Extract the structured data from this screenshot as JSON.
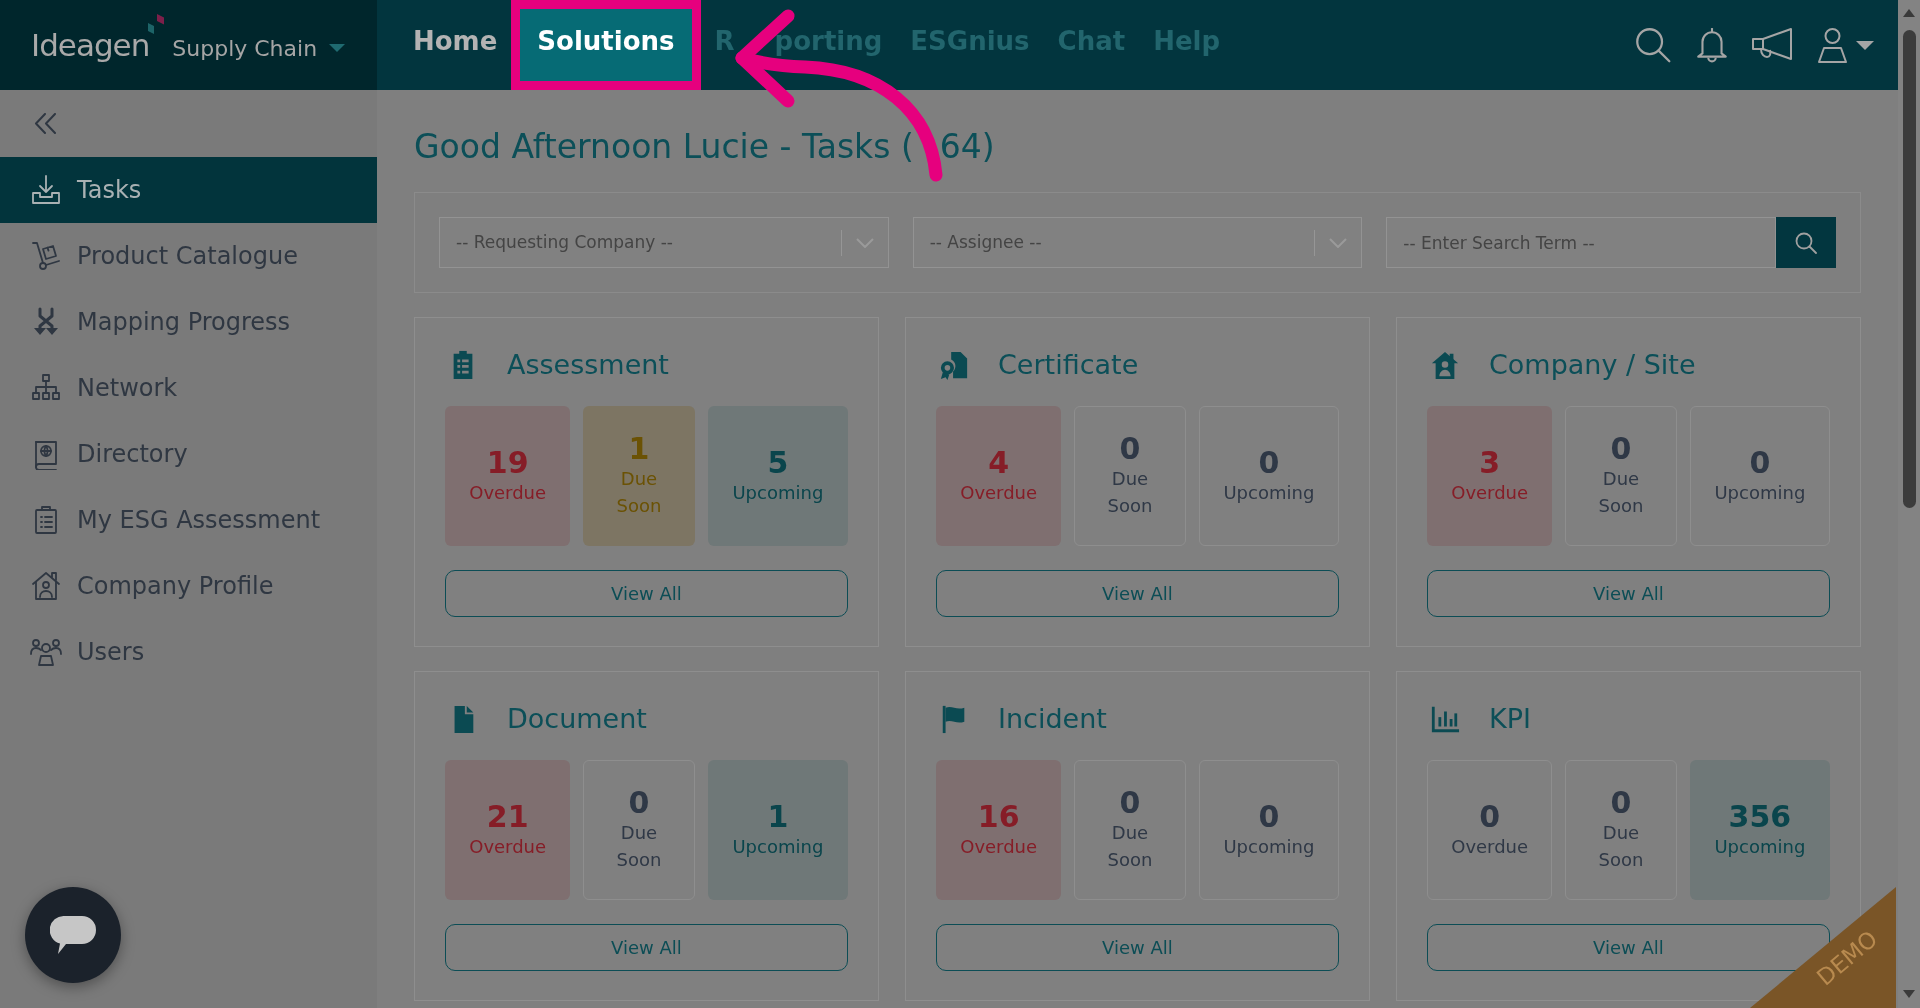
{
  "brand": {
    "name": "Ideagen",
    "product": "Supply Chain"
  },
  "nav": [
    {
      "label": [
        "Home"
      ],
      "selected": false,
      "muted": false,
      "spotlight": false
    },
    {
      "label": [
        "Solutions"
      ],
      "selected": true,
      "muted": false,
      "spotlight": true
    },
    {
      "label": [
        "R",
        "porting"
      ],
      "selected": false,
      "muted": true,
      "spotlight": false
    },
    {
      "label": [
        "ESGnius"
      ],
      "selected": false,
      "muted": true,
      "spotlight": false
    },
    {
      "label": [
        "Chat"
      ],
      "selected": false,
      "muted": true,
      "spotlight": false
    },
    {
      "label": [
        "Help"
      ],
      "selected": false,
      "muted": true,
      "spotlight": false
    }
  ],
  "sidebar": {
    "items": [
      {
        "label": "Tasks",
        "selected": true
      },
      {
        "label": "Product Catalogue",
        "selected": false
      },
      {
        "label": "Mapping Progress",
        "selected": false
      },
      {
        "label": "Network",
        "selected": false
      },
      {
        "label": "Directory",
        "selected": false
      },
      {
        "label": "My ESG Assessment",
        "selected": false
      },
      {
        "label": "Company Profile",
        "selected": false
      },
      {
        "label": "Users",
        "selected": false
      }
    ]
  },
  "page_title": [
    "Good Afternoon Lucie - Tasks (",
    "64)"
  ],
  "filters": [
    {
      "kind": "select",
      "placeholder": "-- Requesting Company --"
    },
    {
      "kind": "select",
      "placeholder": "-- Assignee --"
    },
    {
      "kind": "search",
      "placeholder": "-- Enter Search Term --"
    }
  ],
  "cards": [
    {
      "title": "Assessment",
      "stats": [
        {
          "kind": "overdue",
          "value": "19",
          "label": "Overdue",
          "highlighted": true
        },
        {
          "kind": "soon",
          "value": "1",
          "label": "Due Soon",
          "highlighted": true
        },
        {
          "kind": "upcoming",
          "value": "5",
          "label": "Upcoming",
          "highlighted": true
        }
      ],
      "action": "View All"
    },
    {
      "title": "Certificate",
      "stats": [
        {
          "kind": "overdue",
          "value": "4",
          "label": "Overdue",
          "highlighted": true
        },
        {
          "kind": "soon",
          "value": "0",
          "label": "Due Soon",
          "highlighted": false
        },
        {
          "kind": "upcoming",
          "value": "0",
          "label": "Upcoming",
          "highlighted": false
        }
      ],
      "action": "View All"
    },
    {
      "title": "Company / Site",
      "stats": [
        {
          "kind": "overdue",
          "value": "3",
          "label": "Overdue",
          "highlighted": true
        },
        {
          "kind": "soon",
          "value": "0",
          "label": "Due Soon",
          "highlighted": false
        },
        {
          "kind": "upcoming",
          "value": "0",
          "label": "Upcoming",
          "highlighted": false
        }
      ],
      "action": "View All"
    },
    {
      "title": "Document",
      "stats": [
        {
          "kind": "overdue",
          "value": "21",
          "label": "Overdue",
          "highlighted": true
        },
        {
          "kind": "soon",
          "value": "0",
          "label": "Due Soon",
          "highlighted": false
        },
        {
          "kind": "upcoming",
          "value": "1",
          "label": "Upcoming",
          "highlighted": true
        }
      ],
      "action": "View All"
    },
    {
      "title": "Incident",
      "stats": [
        {
          "kind": "overdue",
          "value": "16",
          "label": "Overdue",
          "highlighted": true
        },
        {
          "kind": "soon",
          "value": "0",
          "label": "Due Soon",
          "highlighted": false
        },
        {
          "kind": "upcoming",
          "value": "0",
          "label": "Upcoming",
          "highlighted": false
        }
      ],
      "action": "View All"
    },
    {
      "title": "KPI",
      "stats": [
        {
          "kind": "overdue",
          "value": "0",
          "label": "Overdue",
          "highlighted": false
        },
        {
          "kind": "soon",
          "value": "0",
          "label": "Due Soon",
          "highlighted": false
        },
        {
          "kind": "upcoming",
          "value": "356",
          "label": "Upcoming",
          "highlighted": true
        }
      ],
      "action": "View All"
    }
  ],
  "ribbon": "DEMO"
}
